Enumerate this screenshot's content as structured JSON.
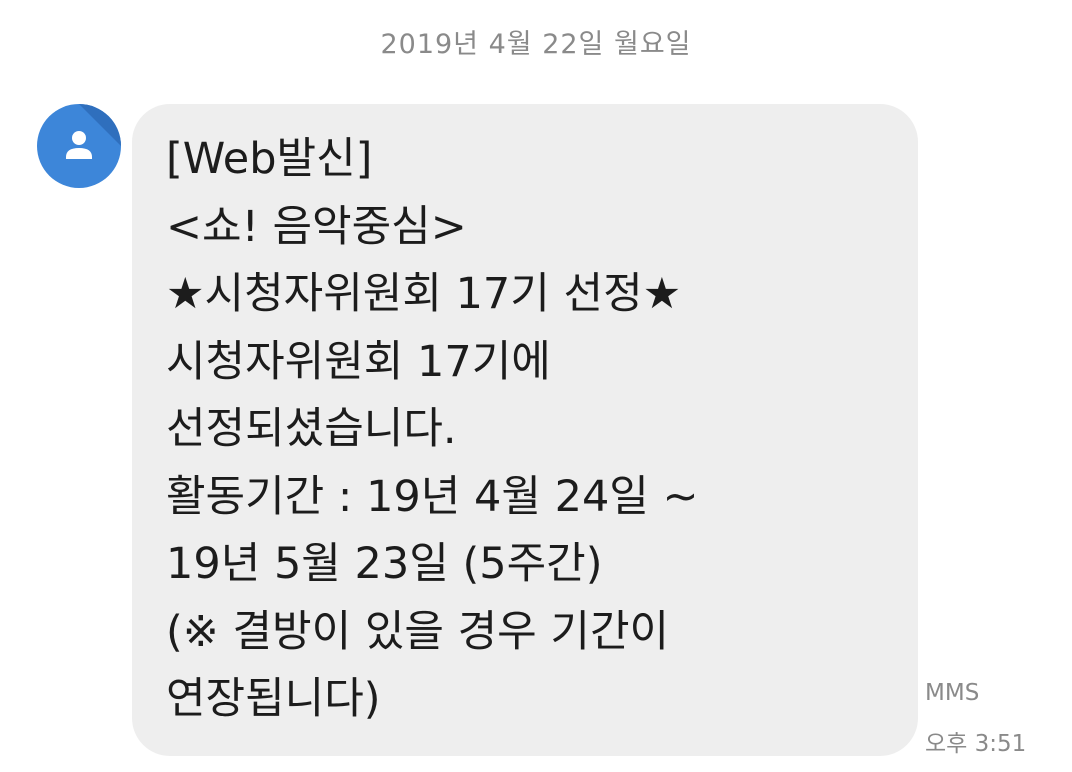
{
  "conversation": {
    "date_header": "2019년 4월 22일 월요일"
  },
  "sender": {
    "avatar_icon": "person-icon",
    "avatar_color": "#3d86d9"
  },
  "message": {
    "lines": [
      "[Web발신]",
      "<쇼! 음악중심>",
      "★시청자위원회 17기 선정★",
      "시청자위원회 17기에",
      "선정되셨습니다.",
      "활동기간 : 19년 4월 24일 ~",
      "19년 5월 23일 (5주간)",
      "(※ 결방이 있을 경우 기간이",
      "연장됩니다)"
    ],
    "type": "MMS",
    "time": "오후 3:51",
    "bubble_color": "#eeeeee"
  }
}
